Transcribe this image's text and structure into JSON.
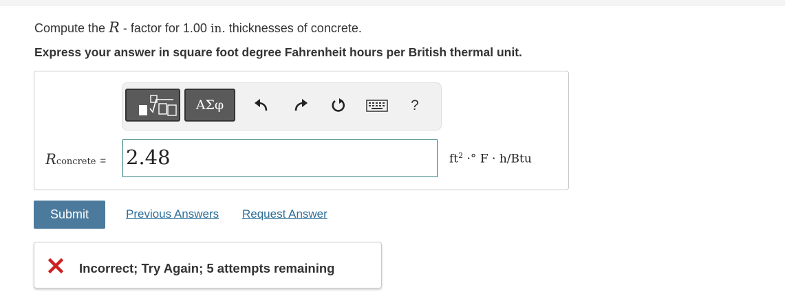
{
  "question": {
    "prefix": "Compute the",
    "symbol": "R",
    "middle": " - factor for 1.00 ",
    "unit": "in.",
    "suffix": " thicknesses of concrete."
  },
  "instruction": "Express your answer in square foot degree Fahrenheit hours per British thermal unit.",
  "toolbar": {
    "symbols_label": "ΑΣφ",
    "help_label": "?",
    "icons": [
      "templates-icon",
      "undo-icon",
      "redo-icon",
      "reset-icon",
      "keyboard-icon",
      "help-icon"
    ]
  },
  "answer": {
    "variable": "R",
    "subscript": "concrete",
    "equals": "=",
    "value": "2.48",
    "units": {
      "base": "ft",
      "exp": "2",
      "rest": " ·° F · h/Btu"
    }
  },
  "actions": {
    "submit_label": "Submit",
    "previous_answers_label": "Previous Answers",
    "request_answer_label": "Request Answer"
  },
  "feedback": {
    "message": "Incorrect; Try Again; 5 attempts remaining",
    "status_color": "#cc2222"
  },
  "colors": {
    "submit_bg": "#4b7a9d",
    "link": "#2e6e99",
    "input_border": "#2d7a7a"
  }
}
